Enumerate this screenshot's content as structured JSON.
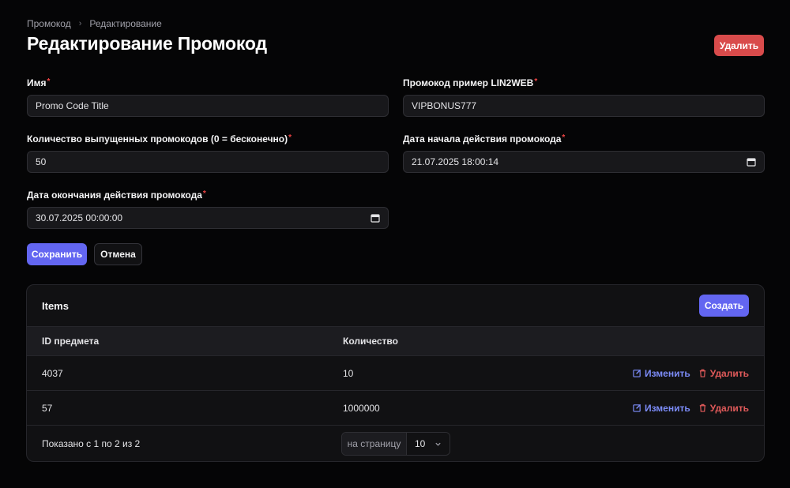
{
  "breadcrumb": {
    "items": [
      "Промокод",
      "Редактирование"
    ],
    "separator": "›"
  },
  "page": {
    "title": "Редактирование Промокод",
    "delete_label": "Удалить"
  },
  "form": {
    "name": {
      "label": "Имя",
      "required_mark": "*",
      "value": "Promo Code Title"
    },
    "code": {
      "label": "Промокод пример LIN2WEB",
      "required_mark": "*",
      "value": "VIPBONUS777"
    },
    "count": {
      "label": "Количество выпущенных промокодов (0 = бесконечно)",
      "required_mark": "*",
      "value": "50"
    },
    "start_date": {
      "label": "Дата начала действия промокода",
      "required_mark": "*",
      "value": "21.07.2025 18:00:14",
      "icon": "calendar-icon"
    },
    "end_date": {
      "label": "Дата окончания действия промокода",
      "required_mark": "*",
      "value": "30.07.2025 00:00:00",
      "icon": "calendar-icon"
    },
    "save_label": "Сохранить",
    "cancel_label": "Отмена"
  },
  "items": {
    "title": "Items",
    "create_label": "Создать",
    "columns": [
      "ID предмета",
      "Количество"
    ],
    "rows": [
      {
        "id": "4037",
        "qty": "10",
        "edit_label": "Изменить",
        "delete_label": "Удалить"
      },
      {
        "id": "57",
        "qty": "1000000",
        "edit_label": "Изменить",
        "delete_label": "Удалить"
      }
    ],
    "summary": "Показано с 1 по 2 из 2",
    "per_page_label": "на страницу",
    "per_page_value": "10"
  },
  "colors": {
    "background": "#050506",
    "primary": "#6366f1",
    "danger": "#d94b4b",
    "edit_link": "#7c8cf8",
    "delete_link": "#e05a5a"
  }
}
